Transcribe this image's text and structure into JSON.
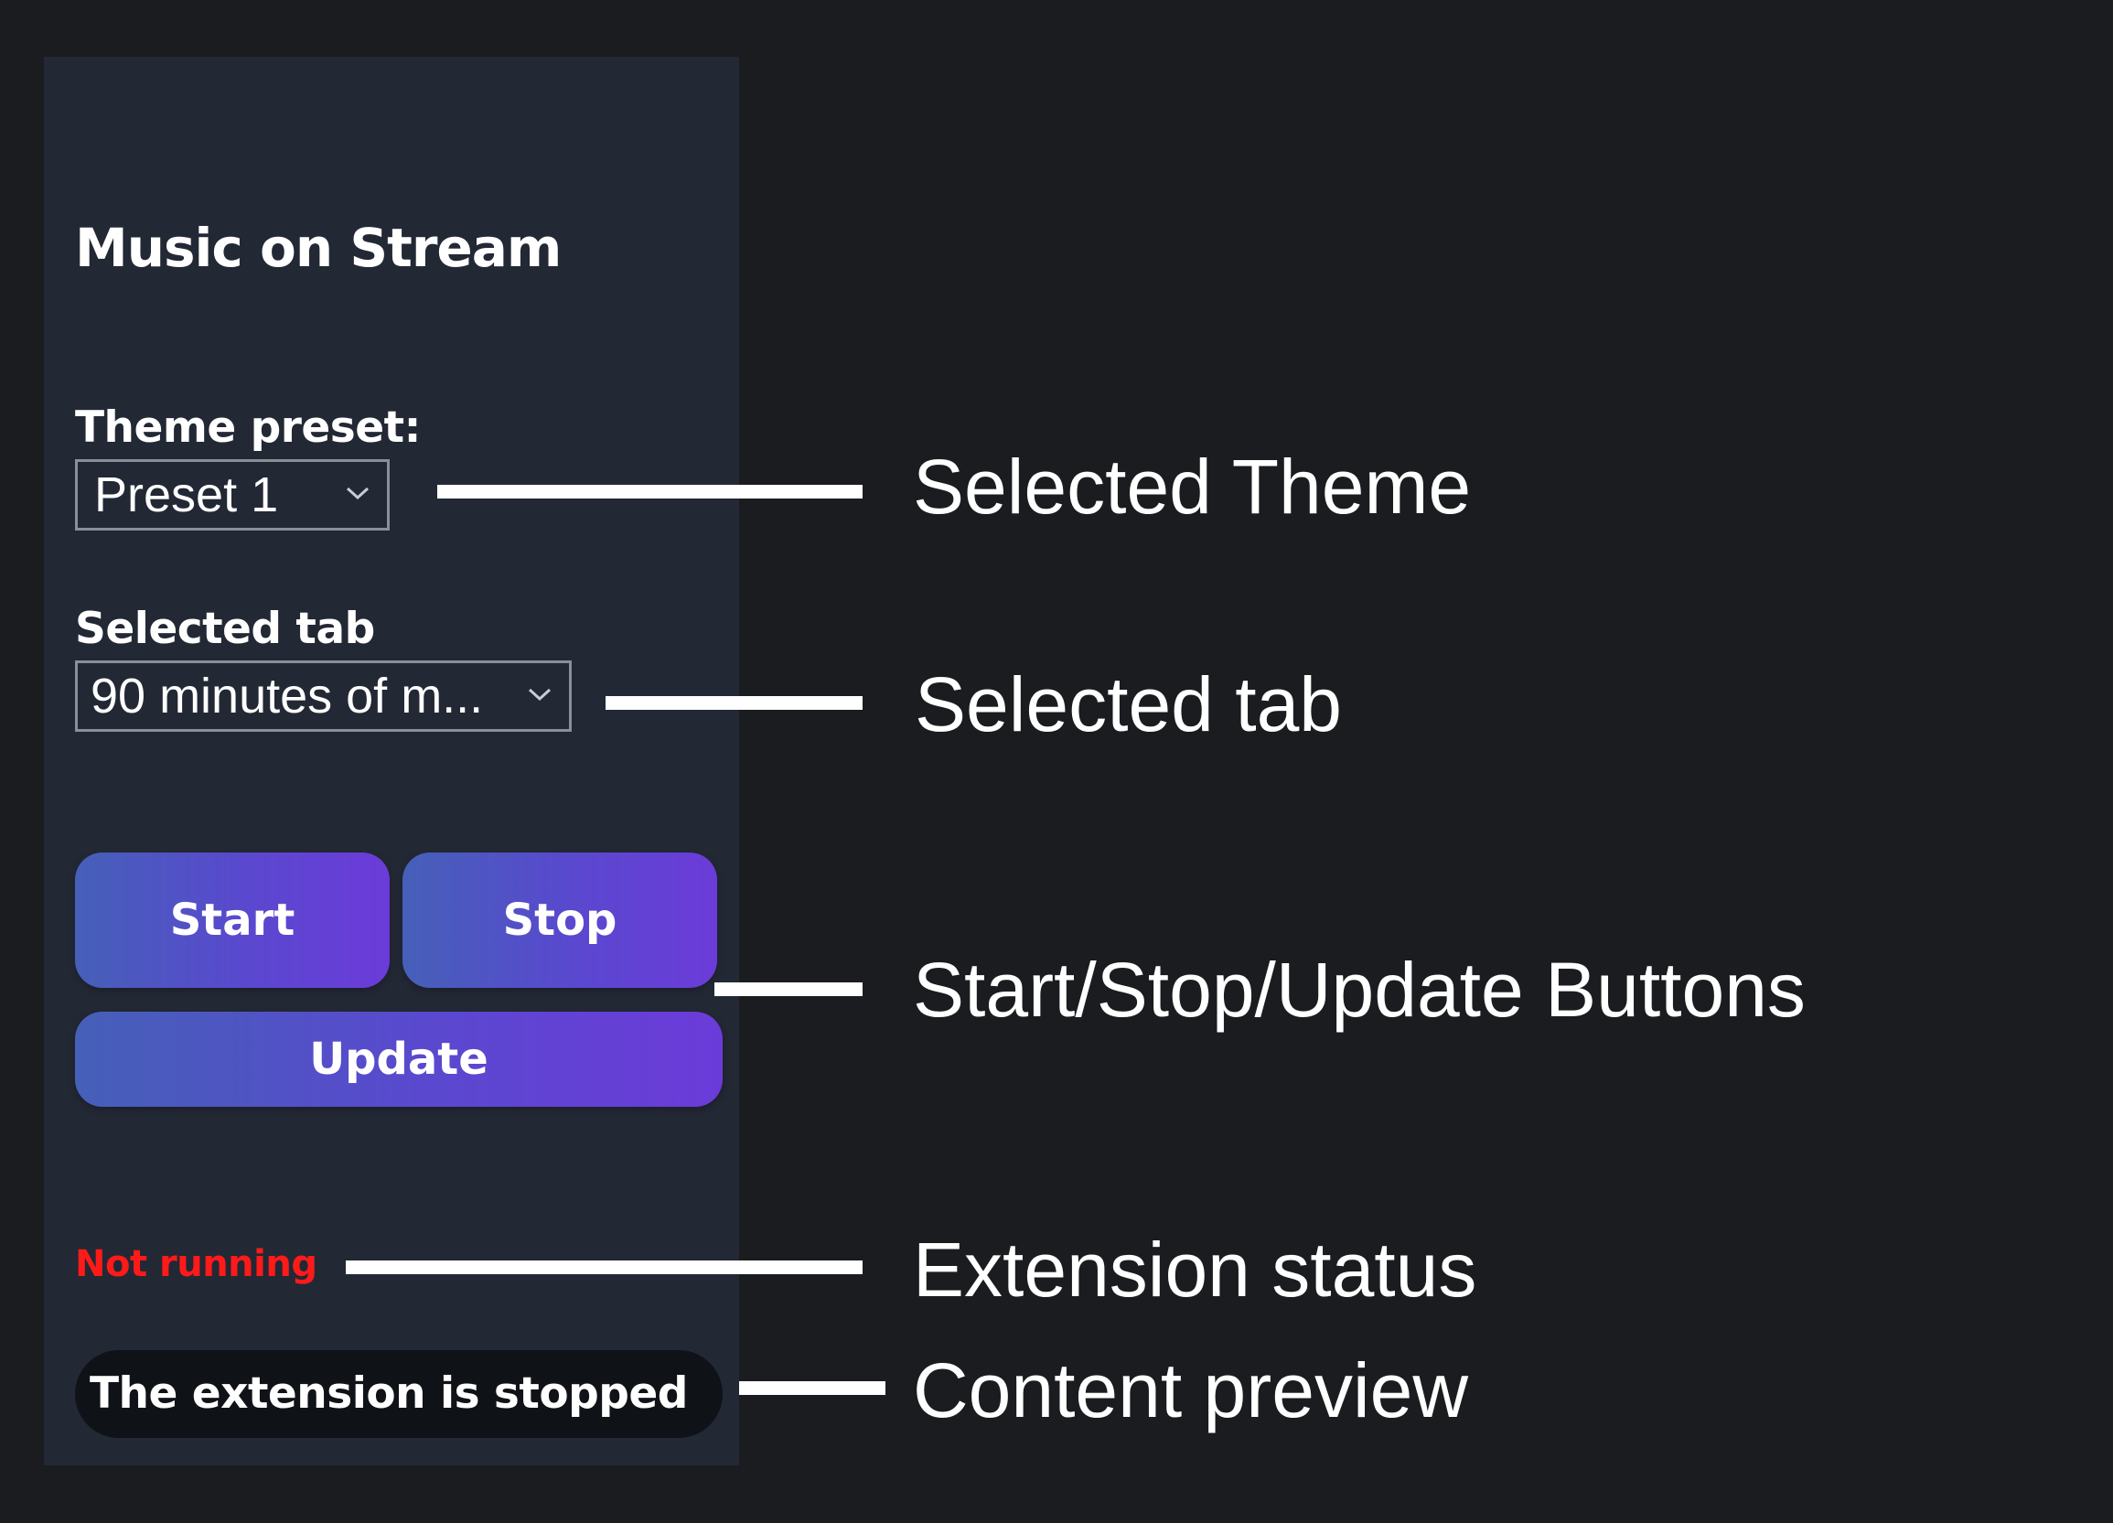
{
  "panel": {
    "title": "Music on Stream",
    "theme_preset": {
      "label": "Theme preset:",
      "value": "Preset 1"
    },
    "selected_tab": {
      "label": "Selected tab",
      "value": "90 minutes of m..."
    },
    "buttons": {
      "start": "Start",
      "stop": "Stop",
      "update": "Update"
    },
    "status": {
      "text": "Not running",
      "color": "#ff1a1a"
    },
    "preview": {
      "text": "The extension is stopped"
    }
  },
  "annotations": {
    "selected_theme": "Selected Theme",
    "selected_tab": "Selected tab",
    "buttons": "Start/Stop/Update Buttons",
    "extension_status": "Extension status",
    "content_preview": "Content preview"
  },
  "colors": {
    "page_background": "#1a1c20",
    "panel_background": "#232835",
    "button_gradient_start": "#4560b8",
    "button_gradient_end": "#6b3bd9"
  }
}
